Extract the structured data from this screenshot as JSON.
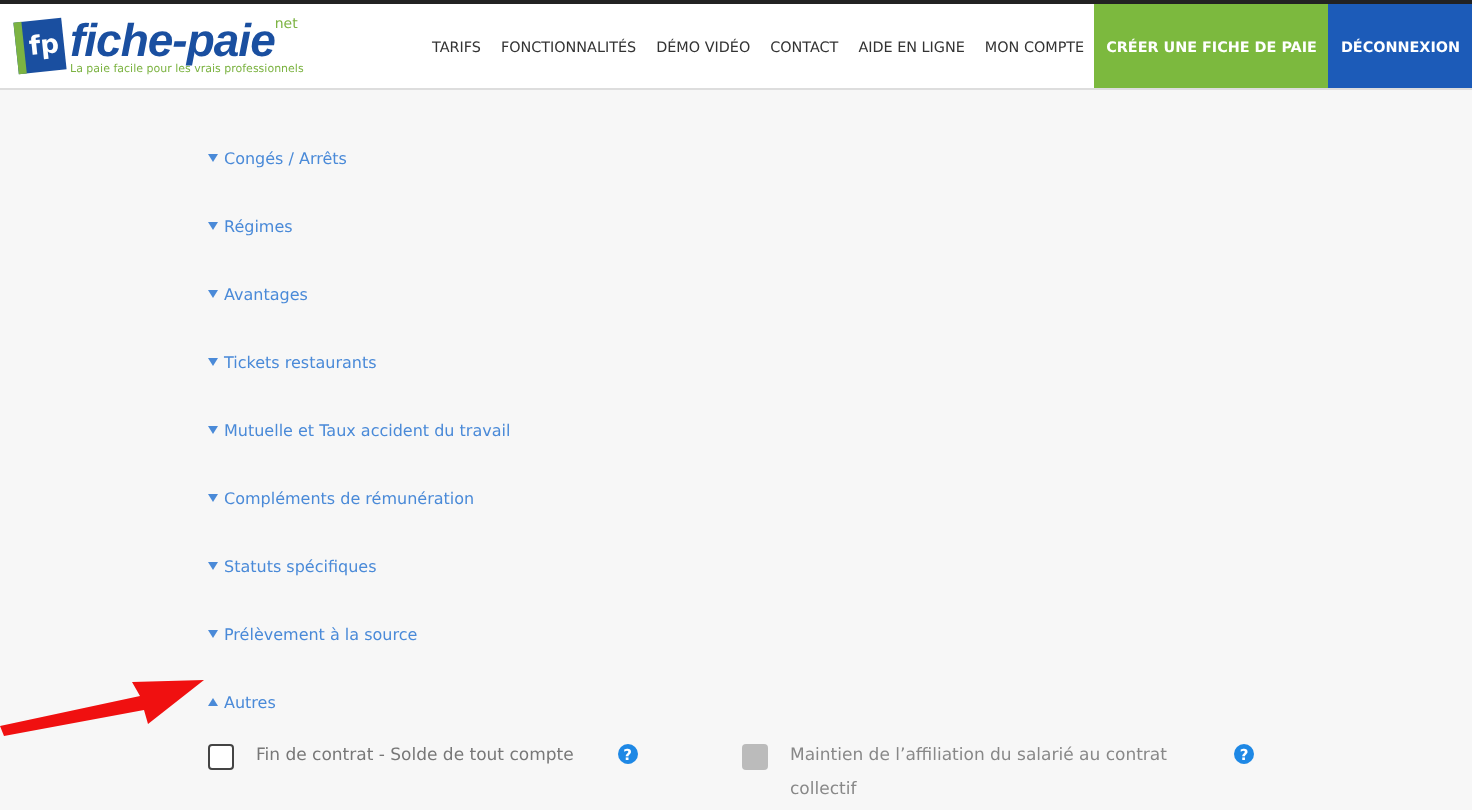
{
  "header": {
    "logo": {
      "badge": "fp",
      "name": "fiche-paie",
      "suffix": "net",
      "tagline": "La paie facile pour les vrais professionnels"
    },
    "nav": [
      {
        "label": "TARIFS",
        "kind": "link"
      },
      {
        "label": "FONCTIONNALITÉS",
        "kind": "link"
      },
      {
        "label": "DÉMO VIDÉO",
        "kind": "link"
      },
      {
        "label": "CONTACT",
        "kind": "link"
      },
      {
        "label": "AIDE EN LIGNE",
        "kind": "link"
      },
      {
        "label": "MON COMPTE",
        "kind": "link"
      },
      {
        "label": "CRÉER UNE FICHE DE PAIE",
        "kind": "primary"
      },
      {
        "label": "DÉCONNEXION",
        "kind": "secondary"
      }
    ]
  },
  "sections": [
    {
      "title": "Congés / Arrêts",
      "expanded": false
    },
    {
      "title": "Régimes",
      "expanded": false
    },
    {
      "title": "Avantages",
      "expanded": false
    },
    {
      "title": "Tickets restaurants",
      "expanded": false
    },
    {
      "title": "Mutuelle et Taux accident du travail",
      "expanded": false
    },
    {
      "title": "Compléments de rémunération",
      "expanded": false
    },
    {
      "title": "Statuts spécifiques",
      "expanded": false
    },
    {
      "title": "Prélèvement à la source",
      "expanded": false
    },
    {
      "title": "Autres",
      "expanded": true
    }
  ],
  "options": [
    {
      "label": "Fin de contrat - Solde de tout compte",
      "checked": false,
      "disabled": false,
      "help": "?"
    },
    {
      "label": "Maintien de l’affiliation du salarié au contrat collectif",
      "checked": false,
      "disabled": true,
      "help": "?"
    }
  ]
}
